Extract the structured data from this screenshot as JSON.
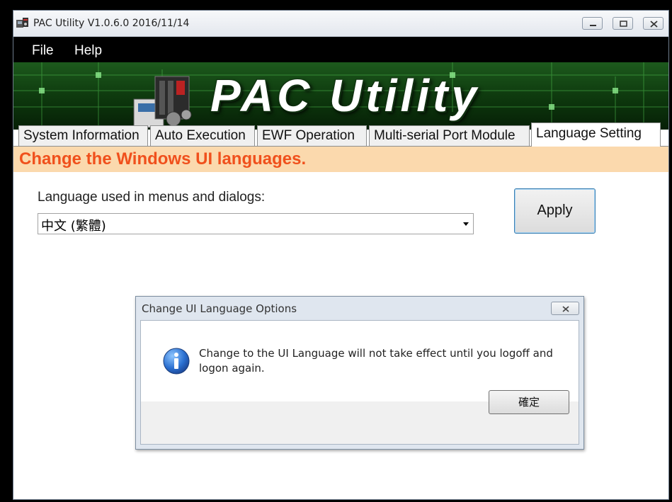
{
  "window": {
    "title": "PAC Utility V1.0.6.0  2016/11/14",
    "icon": "pac-app-icon",
    "controls": [
      "minimize-icon",
      "maximize-icon",
      "close-icon"
    ]
  },
  "menu": {
    "items": [
      {
        "label": "File"
      },
      {
        "label": "Help"
      }
    ]
  },
  "banner": {
    "title": "PAC Utility",
    "background_color": "#0a2a0a"
  },
  "tabs": [
    {
      "label": "System Information",
      "active": false
    },
    {
      "label": "Auto Execution",
      "active": false
    },
    {
      "label": "EWF Operation",
      "active": false
    },
    {
      "label": "Multi-serial Port Module",
      "active": false
    },
    {
      "label": "Language Setting",
      "active": true
    }
  ],
  "language_page": {
    "heading": "Change the Windows UI languages.",
    "heading_color": "#f0501c",
    "heading_bg": "#fbd9ad",
    "language_label": "Language used in menus and dialogs:",
    "language_selected": "中文 (繁體)",
    "apply_label": "Apply"
  },
  "dialog": {
    "title": "Change UI Language Options",
    "message": "Change to the UI Language will not take effect until you logoff and logon again.",
    "ok_label": "確定",
    "icon": "info-icon"
  }
}
